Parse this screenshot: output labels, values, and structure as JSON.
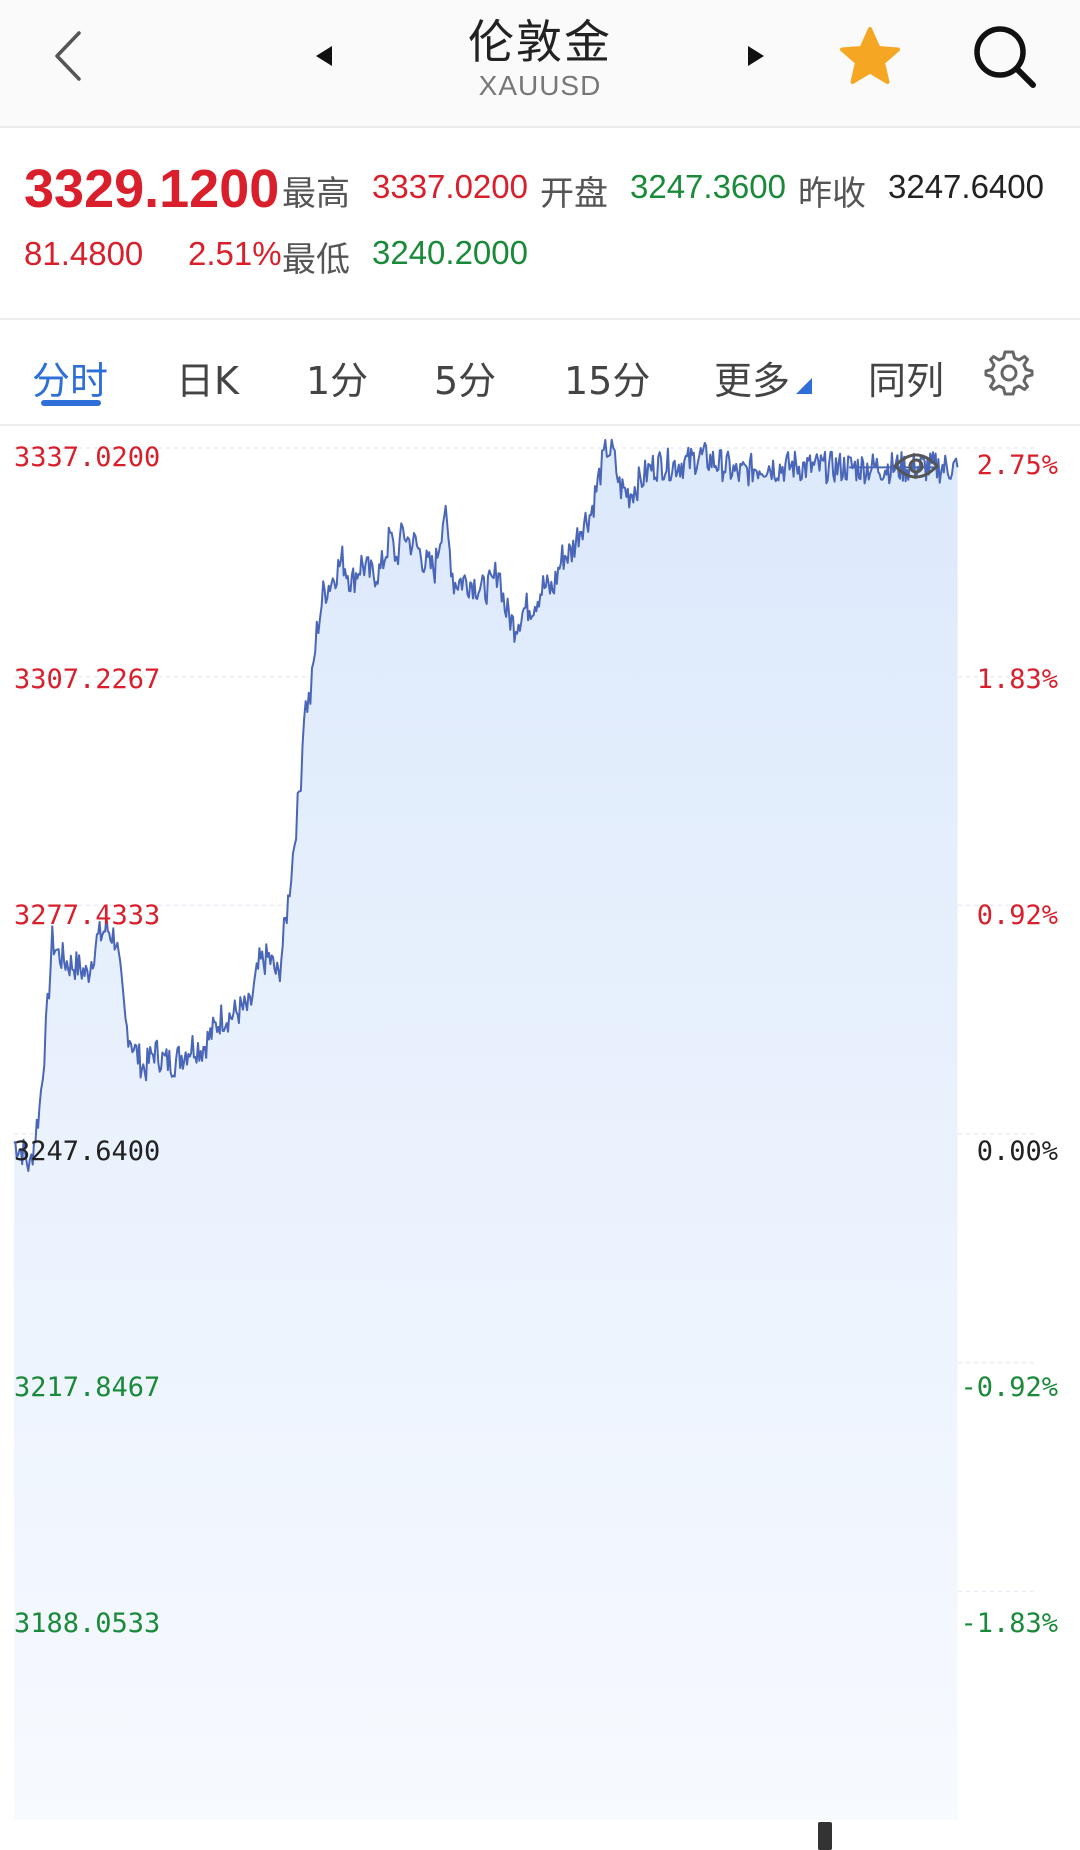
{
  "header": {
    "title": "伦敦金",
    "symbol": "XAUUSD"
  },
  "quote": {
    "price": "3329.1200",
    "change": "81.4800",
    "change_pct": "2.51%",
    "high_label": "最高",
    "high": "3337.0200",
    "open_label": "开盘",
    "open": "3247.3600",
    "prev_close_label": "昨收",
    "prev_close": "3247.6400",
    "low_label": "最低",
    "low": "3240.2000"
  },
  "tabs": [
    {
      "label": "分时",
      "active": true
    },
    {
      "label": "日K"
    },
    {
      "label": "1分"
    },
    {
      "label": "5分"
    },
    {
      "label": "15分"
    },
    {
      "label": "更多"
    },
    {
      "label": "同列"
    }
  ],
  "colors": {
    "up": "#d91f2b",
    "down": "#1a8a3a",
    "accent": "#2f6fd8",
    "line": "#4a66b8",
    "fill": "#dce9fb"
  },
  "icons": {
    "back": "chevron-left-icon",
    "prev": "triangle-left-icon",
    "next": "triangle-right-icon",
    "favorite": "star-icon",
    "search": "search-icon",
    "settings": "gear-icon",
    "toggle_view": "eye-icon"
  },
  "chart_data": {
    "type": "area",
    "y_left_ticks": [
      "3337.0200",
      "3307.2267",
      "3277.4333",
      "3247.6400",
      "3217.8467",
      "3188.0533"
    ],
    "y_right_ticks": [
      "2.75%",
      "1.83%",
      "0.92%",
      "0.00%",
      "-0.92%",
      "-1.83%"
    ],
    "ylim": [
      3158.26,
      3337.02
    ],
    "reference_value": 3247.64,
    "current_value": 3329.12,
    "x": [
      0,
      3,
      5,
      8,
      10,
      12,
      14,
      17,
      20,
      23,
      26,
      29,
      32,
      35,
      38,
      41,
      44,
      47,
      50,
      53,
      56,
      59,
      62,
      65,
      68,
      71,
      74,
      77,
      80,
      83,
      86,
      88,
      90,
      91,
      93,
      95,
      97,
      100,
      103,
      106,
      109,
      112,
      115,
      118,
      120,
      122,
      124,
      126,
      129,
      132,
      135,
      138,
      141,
      144,
      147,
      150,
      152,
      154,
      157,
      160,
      163,
      166,
      169,
      172,
      175,
      178,
      181,
      184,
      186,
      188,
      190,
      193,
      196,
      198,
      200,
      203,
      206,
      209,
      212,
      215,
      218,
      221,
      224,
      227,
      230,
      233,
      236,
      239,
      242,
      245,
      248,
      251,
      254,
      257,
      260,
      263,
      266,
      269,
      272,
      275,
      278,
      281,
      284,
      287,
      290,
      293,
      296,
      299,
      302,
      305,
      308,
      311,
      314,
      317,
      320
    ],
    "values": [
      3246.5,
      3245.3,
      3243.2,
      3251.0,
      3261.0,
      3272.8,
      3271.0,
      3269.8,
      3269.5,
      3268.3,
      3272.9,
      3274.5,
      3273.0,
      3262.0,
      3258.5,
      3256.0,
      3258.5,
      3257.2,
      3257.0,
      3258.0,
      3259.2,
      3258.8,
      3260.7,
      3262.8,
      3263.0,
      3263.8,
      3264.0,
      3269.8,
      3270.6,
      3268.0,
      3278.0,
      3286.0,
      3294.3,
      3303.0,
      3304.5,
      3313.0,
      3318.0,
      3320.0,
      3322.5,
      3319.5,
      3322.0,
      3320.5,
      3321.0,
      3325.5,
      3322.5,
      3326.2,
      3324.8,
      3324.5,
      3322.0,
      3321.2,
      3328.8,
      3319.5,
      3319.8,
      3319.5,
      3318.5,
      3319.2,
      3321.5,
      3316.2,
      3313.8,
      3316.0,
      3316.7,
      3319.0,
      3318.5,
      3322.8,
      3323.5,
      3327.0,
      3328.5,
      3334.0,
      3337.0,
      3336.2,
      3332.0,
      3331.0,
      3332.5,
      3333.5,
      3334.5,
      3335.0,
      3334.8,
      3335.0,
      3335.2,
      3336.0,
      3335.5,
      3335.0,
      3334.5,
      3333.5,
      3334.0,
      3334.5,
      3334.8,
      3334.5,
      3334.5,
      3334.8,
      3334.5,
      3334.5,
      3334.5,
      3334.5,
      3334.5,
      3334.5,
      3334.5,
      3334.5,
      3334.5,
      3334.5,
      3334.5,
      3334.5,
      3334.5,
      3334.5,
      3334.5,
      3334.5,
      3334.5,
      3334.5,
      3334.5,
      3334.5,
      3334.5,
      3334.5,
      3334.5,
      3334.5,
      3334.5
    ],
    "grid": true
  }
}
